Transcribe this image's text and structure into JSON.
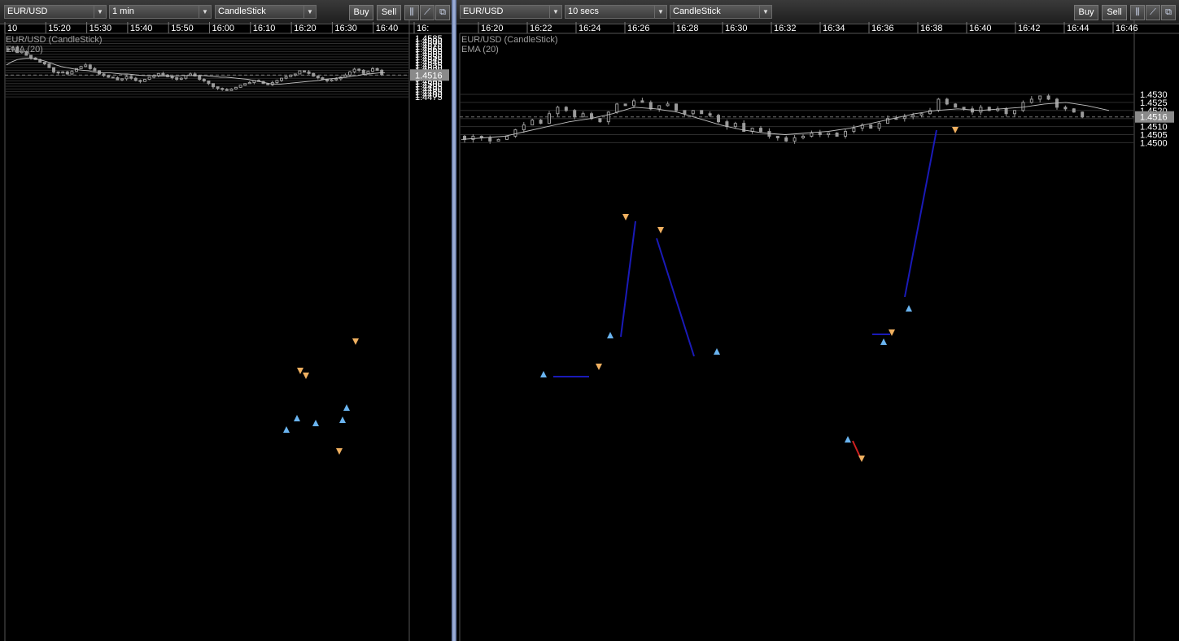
{
  "colors": {
    "background": "#000000",
    "candle": "#9a9a9a",
    "ema": "#c0c0c0",
    "buy_marker": "#6ab4f0",
    "sell_marker": "#f0b060",
    "trend_line": "#1a1ab8",
    "trend_line_red": "#d02020",
    "last_price_badge": "#8a8a8a"
  },
  "left": {
    "toolbar": {
      "symbol": "EUR/USD",
      "interval": "1 min",
      "chart_type": "CandleStick",
      "buy_label": "Buy",
      "sell_label": "Sell",
      "icons": [
        "indicators-icon",
        "draw-line-icon",
        "detach-window-icon"
      ]
    },
    "legend": {
      "series": "EUR/USD (CandleStick)",
      "indicator": "EMA (20)"
    },
    "last_price": "1.4516"
  },
  "right": {
    "toolbar": {
      "symbol": "EUR/USD",
      "interval": "10 secs",
      "chart_type": "CandleStick",
      "buy_label": "Buy",
      "sell_label": "Sell",
      "icons": [
        "indicators-icon",
        "draw-line-icon",
        "detach-window-icon"
      ]
    },
    "legend": {
      "series": "EUR/USD (CandleStick)",
      "indicator": "EMA (20)"
    },
    "last_price": "1.4516"
  },
  "chart_data": [
    {
      "type": "candlestick",
      "title": "EUR/USD (CandleStick)",
      "indicator": "EMA (20)",
      "interval": "1 min",
      "x_ticks": [
        "10",
        "15:20",
        "15:30",
        "15:40",
        "15:50",
        "16:00",
        "16:10",
        "16:20",
        "16:30",
        "16:40",
        "16:"
      ],
      "y_ticks": [
        "1.4585",
        "1.4580",
        "1.4575",
        "1.4570",
        "1.4565",
        "1.4560",
        "1.4555",
        "1.4550",
        "1.4545",
        "1.4540",
        "1.4535",
        "1.4530",
        "1.4525",
        "1.4520",
        "1.4515",
        "1.4510",
        "1.4505",
        "1.4500",
        "1.4495",
        "1.4490",
        "1.4485",
        "1.4480",
        "1.4475"
      ],
      "ylim": [
        1.4473,
        1.4587
      ],
      "grid": true,
      "last_price": 1.4516,
      "close": [
        1.4563,
        1.4568,
        1.4558,
        1.456,
        1.4553,
        1.4548,
        1.4545,
        1.454,
        1.4537,
        1.453,
        1.4522,
        1.452,
        1.4522,
        1.4518,
        1.4523,
        1.4528,
        1.4532,
        1.4535,
        1.4528,
        1.4524,
        1.4518,
        1.4515,
        1.4512,
        1.4511,
        1.4507,
        1.4509,
        1.4513,
        1.451,
        1.4506,
        1.4504,
        1.4508,
        1.4512,
        1.4515,
        1.4519,
        1.4516,
        1.4513,
        1.4511,
        1.4508,
        1.451,
        1.4515,
        1.4518,
        1.4514,
        1.4508,
        1.4505,
        1.45,
        1.4494,
        1.4491,
        1.4489,
        1.4487,
        1.449,
        1.4493,
        1.4497,
        1.45,
        1.4502,
        1.4506,
        1.4504,
        1.45,
        1.4498,
        1.4502,
        1.4506,
        1.451,
        1.4513,
        1.4516,
        1.4518,
        1.4524,
        1.4522,
        1.4519,
        1.4514,
        1.4511,
        1.4508,
        1.4505,
        1.4507,
        1.4509,
        1.4512,
        1.4516,
        1.4522,
        1.4527,
        1.4525,
        1.4519,
        1.4523,
        1.4528,
        1.4525,
        1.4517
      ],
      "ema": [
        1.4535,
        1.4541,
        1.4545,
        1.4547,
        1.4548,
        1.4547,
        1.4545,
        1.4542,
        1.4539,
        1.4535,
        1.4532,
        1.453,
        1.4528,
        1.4526,
        1.4525,
        1.4524,
        1.4522,
        1.4521,
        1.452,
        1.452,
        1.4519,
        1.4518,
        1.4518,
        1.4517,
        1.4516,
        1.4515,
        1.4515,
        1.4515,
        1.4514,
        1.4514,
        1.4514,
        1.4514,
        1.4515,
        1.4515,
        1.4515,
        1.4515,
        1.4515,
        1.4514,
        1.4513,
        1.4512,
        1.4512,
        1.4511,
        1.451,
        1.4509,
        1.4508,
        1.4506,
        1.4504,
        1.4502,
        1.45,
        1.4499,
        1.4499,
        1.45,
        1.4501,
        1.4502,
        1.4503,
        1.4504,
        1.4505,
        1.4506,
        1.4508,
        1.4509,
        1.451,
        1.4511,
        1.4512,
        1.4514,
        1.4515,
        1.4517,
        1.4518,
        1.4519,
        1.452,
        1.452
      ]
    },
    {
      "type": "candlestick",
      "title": "EUR/USD (CandleStick)",
      "indicator": "EMA (20)",
      "interval": "10 secs",
      "x_ticks": [
        "16:20",
        "16:22",
        "16:24",
        "16:26",
        "16:28",
        "16:30",
        "16:32",
        "16:34",
        "16:36",
        "16:38",
        "16:40",
        "16:42",
        "16:44",
        "16:46"
      ],
      "y_ticks": [
        "1.4530",
        "1.4525",
        "1.4520",
        "1.4515",
        "1.4510",
        "1.4505",
        "1.4500"
      ],
      "ylim": [
        1.44985,
        1.45335
      ],
      "grid": true,
      "last_price": 1.4516,
      "close": [
        1.4502,
        1.4504,
        1.4503,
        1.4501,
        1.4502,
        1.4504,
        1.4508,
        1.4511,
        1.4514,
        1.4512,
        1.4518,
        1.4522,
        1.452,
        1.4516,
        1.4518,
        1.4515,
        1.4513,
        1.4519,
        1.4524,
        1.4523,
        1.4526,
        1.4525,
        1.4521,
        1.4523,
        1.4524,
        1.452,
        1.4518,
        1.452,
        1.4518,
        1.4517,
        1.4513,
        1.451,
        1.4512,
        1.4507,
        1.4509,
        1.4507,
        1.4504,
        1.4503,
        1.4501,
        1.4503,
        1.4504,
        1.4506,
        1.4505,
        1.4506,
        1.4504,
        1.4507,
        1.4509,
        1.4511,
        1.4509,
        1.4512,
        1.4515,
        1.4515,
        1.4516,
        1.4517,
        1.4518,
        1.452,
        1.4527,
        1.4524,
        1.4522,
        1.4521,
        1.4519,
        1.4522,
        1.452,
        1.4521,
        1.4518,
        1.452,
        1.4525,
        1.4527,
        1.4529,
        1.4527,
        1.4522,
        1.4521,
        1.4519,
        1.4516
      ],
      "ema": [
        1.4502,
        1.4503,
        1.4504,
        1.4507,
        1.451,
        1.4513,
        1.4515,
        1.4518,
        1.4522,
        1.4521,
        1.4519,
        1.4515,
        1.4511,
        1.4508,
        1.4506,
        1.4505,
        1.4506,
        1.4507,
        1.4509,
        1.4512,
        1.4515,
        1.4518,
        1.452,
        1.4521,
        1.452,
        1.4521,
        1.4522,
        1.4524,
        1.4525,
        1.4523,
        1.452
      ]
    }
  ]
}
